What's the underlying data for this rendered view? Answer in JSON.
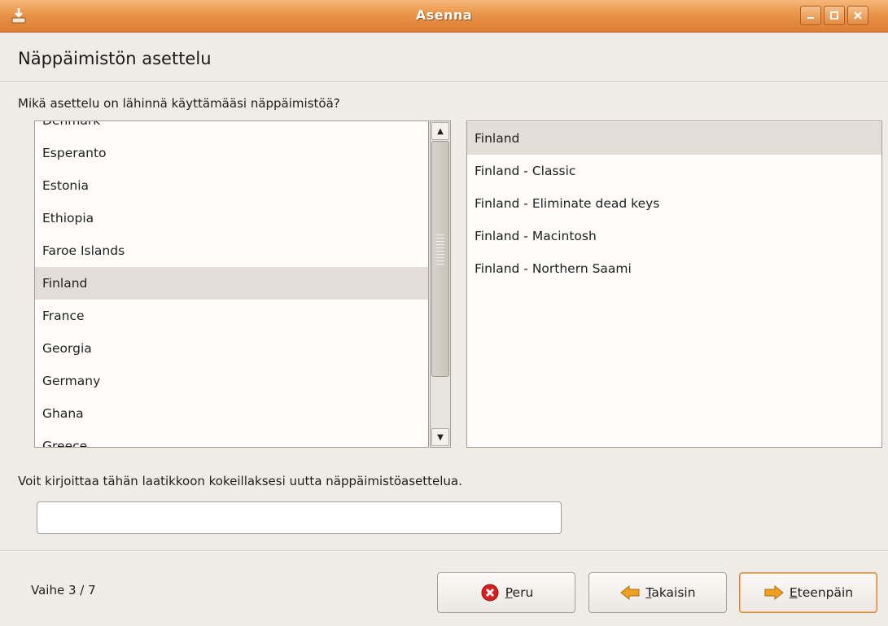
{
  "window": {
    "title": "Asenna",
    "controls": [
      "minimize",
      "maximize",
      "close"
    ]
  },
  "page": {
    "title": "Näppäimistön asettelu",
    "question": "Mikä asettelu on lähinnä käyttämääsi näppäimistöä?",
    "hint": "Voit kirjoittaa tähän laatikkoon kokeillaksesi uutta näppäimistöasettelua."
  },
  "layouts": {
    "items": [
      "Denmark",
      "Esperanto",
      "Estonia",
      "Ethiopia",
      "Faroe Islands",
      "Finland",
      "France",
      "Georgia",
      "Germany",
      "Ghana",
      "Greece"
    ],
    "selected": "Finland"
  },
  "variants": {
    "items": [
      "Finland",
      "Finland - Classic",
      "Finland - Eliminate dead keys",
      "Finland - Macintosh",
      "Finland - Northern Saami"
    ],
    "selected": "Finland"
  },
  "test_input": {
    "value": ""
  },
  "footer": {
    "step": "Vaihe 3 / 7",
    "cancel": {
      "mnemonic": "P",
      "rest": "eru"
    },
    "back": {
      "mnemonic": "T",
      "rest": "akaisin"
    },
    "forward": {
      "mnemonic": "E",
      "rest": "teenpäin"
    }
  },
  "colors": {
    "titlebar": "#e38a42",
    "selection": "#e2ddd7",
    "window_bg": "#efebe7",
    "cancel_icon": "#d42020",
    "arrow_icon": "#f0a020"
  }
}
